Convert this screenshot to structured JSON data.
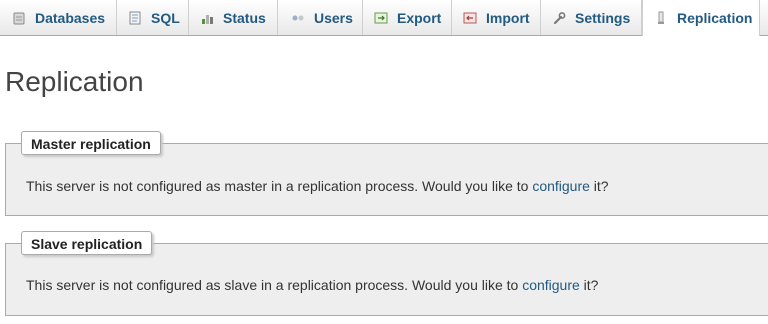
{
  "tabs": [
    {
      "label": "Databases",
      "icon": "database-icon"
    },
    {
      "label": "SQL",
      "icon": "sql-icon"
    },
    {
      "label": "Status",
      "icon": "status-icon"
    },
    {
      "label": "Users",
      "icon": "users-icon"
    },
    {
      "label": "Export",
      "icon": "export-icon"
    },
    {
      "label": "Import",
      "icon": "import-icon"
    },
    {
      "label": "Settings",
      "icon": "wrench-icon"
    },
    {
      "label": "Replication",
      "icon": "replication-icon",
      "active": true
    }
  ],
  "page_title": "Replication",
  "master": {
    "legend": "Master replication",
    "text_before": "This server is not configured as master in a replication process. Would you like to ",
    "link": "configure",
    "text_after": " it?"
  },
  "slave": {
    "legend": "Slave replication",
    "text_before": "This server is not configured as slave in a replication process. Would you like to ",
    "link": "configure",
    "text_after": " it?"
  },
  "colors": {
    "link": "#235a81",
    "panel_bg": "#eeeeee",
    "border": "#aaaaaa"
  }
}
